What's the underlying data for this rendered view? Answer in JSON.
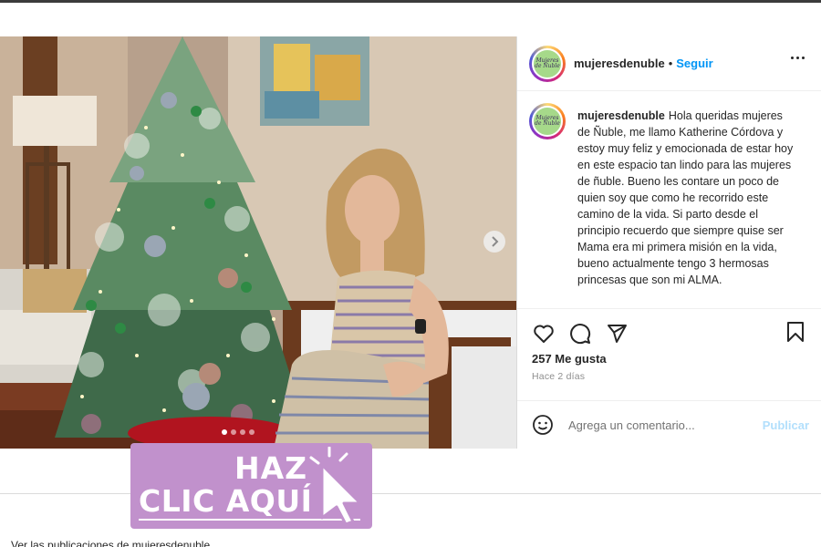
{
  "post": {
    "username": "mujeresdenuble",
    "separator": "•",
    "follow_label": "Seguir",
    "avatar_text": "Mujeres de Ñuble",
    "caption": "Hola queridas mujeres de Ñuble, me llamo Katherine Córdova y estoy muy feliz y emocionada de estar hoy en este espacio tan lindo para las mujeres de ñuble. Bueno les contare un poco de quien soy que como he recorrido este camino de la vida. Si parto desde el principio recuerdo que siempre quise ser Mama era mi primera misión en la vida, bueno actualmente tengo 3 hermosas princesas que son mi ALMA.",
    "likes": "257 Me gusta",
    "time_ago": "Hace 2 días",
    "comment_placeholder": "Agrega un comentario...",
    "publish_label": "Publicar",
    "carousel": {
      "slide_count": 4,
      "active_index": 0
    }
  },
  "icons": {
    "like": "heart-icon",
    "comment": "comment-icon",
    "share": "send-icon",
    "save": "bookmark-icon",
    "emoji": "smiley-icon",
    "more": "more-horizontal-icon",
    "next": "chevron-right-icon",
    "cursor": "pointer-cursor-icon"
  },
  "banner": {
    "line1": "HAZ",
    "line2": "CLIC AQUÍ",
    "background": "#c191cc"
  },
  "below": {
    "text": "Ver las publicaciones de mujeresdenuble"
  },
  "colors": {
    "link_blue": "#0095f6",
    "publish_disabled": "#b2dffc",
    "muted": "#8e8e8e",
    "border": "#dbdbdb"
  }
}
